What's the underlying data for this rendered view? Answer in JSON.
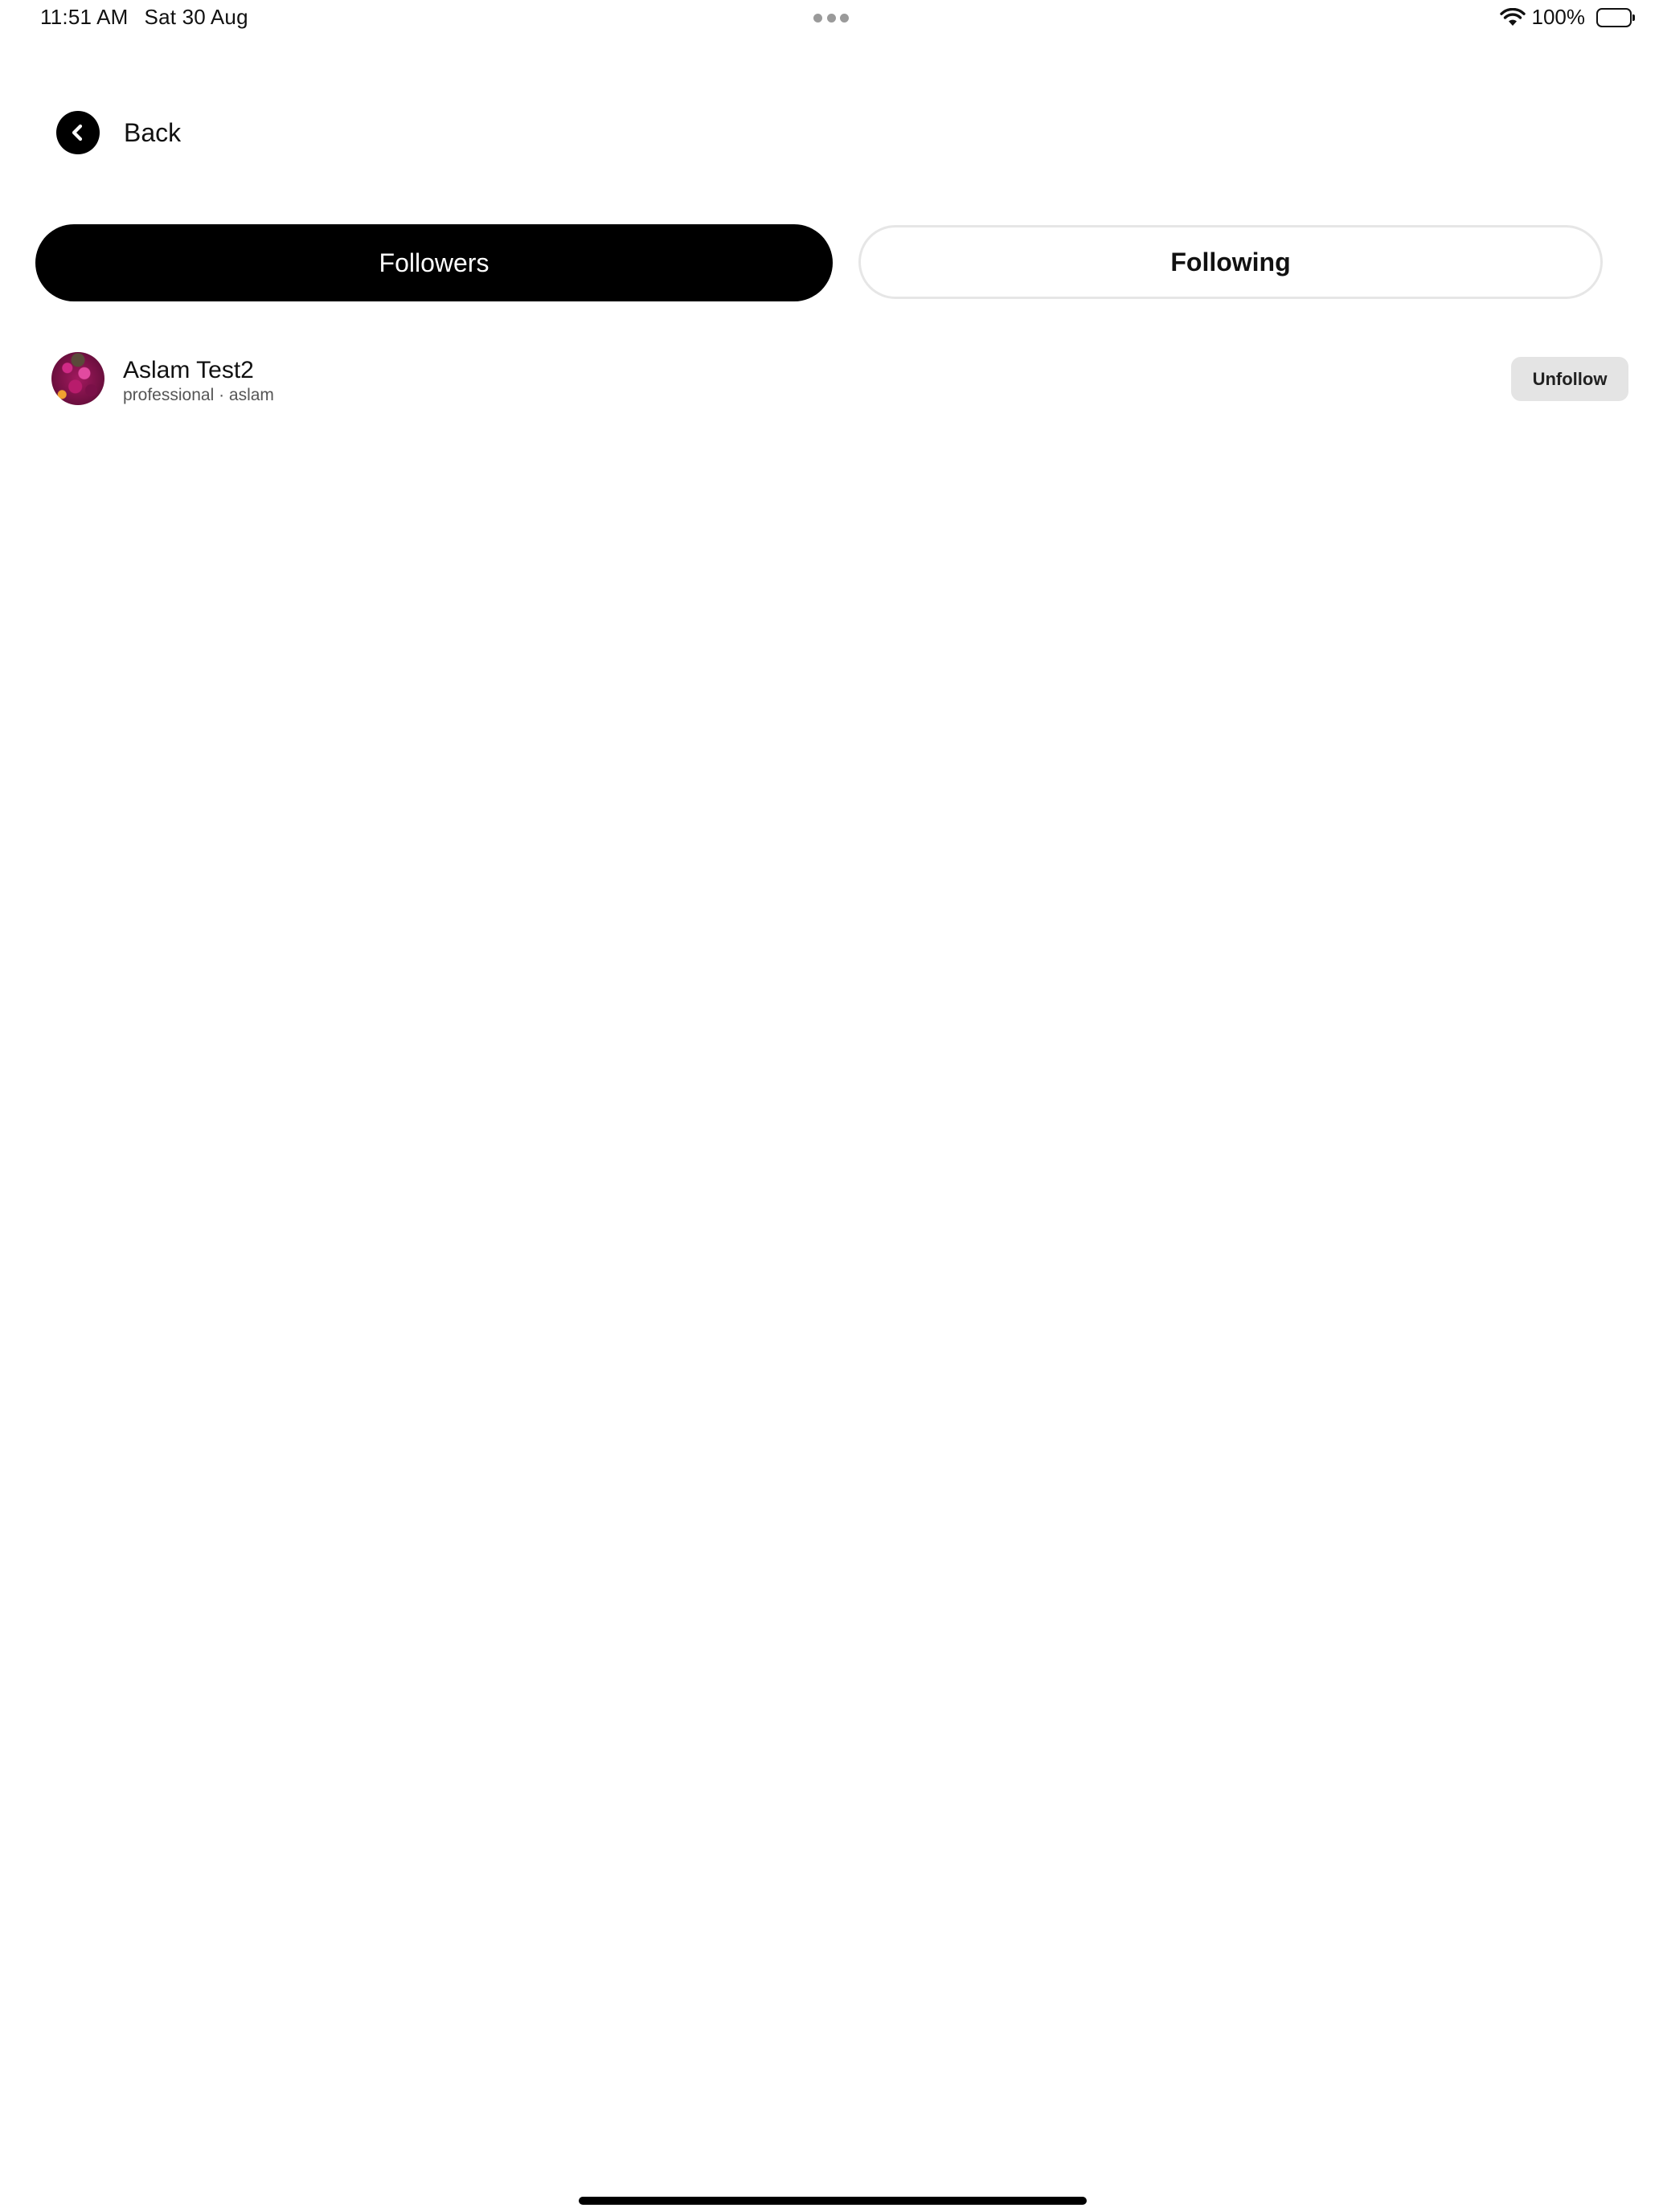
{
  "status_bar": {
    "time": "11:51 AM",
    "date": "Sat 30 Aug",
    "battery_percent": "100%",
    "battery_level": 1.0,
    "wifi_icon": "wifi-icon",
    "battery_icon": "battery-icon",
    "multitask_icon": "more-dots-icon"
  },
  "nav": {
    "back_label": "Back",
    "back_icon": "chevron-left-icon"
  },
  "tabs": [
    {
      "label": "Followers",
      "active": true
    },
    {
      "label": "Following",
      "active": false
    }
  ],
  "users": [
    {
      "name": "Aslam Test2",
      "meta": "professional · aslam",
      "action_label": "Unfollow",
      "avatar_icon": "avatar-photo"
    }
  ],
  "colors": {
    "active_tab_bg": "#000000",
    "active_tab_text": "#ffffff",
    "inactive_tab_border": "#e6e6e6",
    "unfollow_bg": "#e4e4e4"
  }
}
